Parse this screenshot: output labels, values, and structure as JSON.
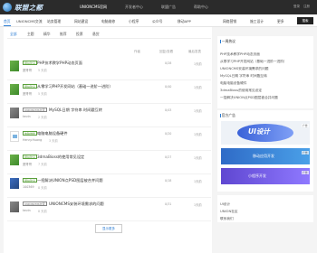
{
  "brand": {
    "logo_text": "联盟之都"
  },
  "top_nav": [
    "UNIONCMS官网",
    "开发者中心",
    "联盟广告",
    "帮助中心"
  ],
  "top_right": [
    "登录",
    "注册"
  ],
  "sub_nav": [
    "首页",
    "UNIONCMS交流",
    "站务管理",
    "网站建设",
    "电脑维修",
    "小程序",
    "公众号",
    "移动APP",
    "网络营销",
    "施工设计",
    "更多"
  ],
  "search_button": "搜索",
  "tabs": [
    "全部",
    "主题",
    "精华",
    "推荐",
    "投票",
    "悬赏"
  ],
  "columns": [
    "作者",
    "回复/查看",
    "最后发表"
  ],
  "threads": [
    {
      "tag": "网站建设",
      "title": "PHP技术教学PHP动态页面",
      "user": "宽哥哥",
      "meta": "5 天前",
      "replies": "0/28",
      "views": "1天前"
    },
    {
      "tag": "网站建设",
      "title": "从零学习PHP开发网站（基础一进阶一进阶）",
      "user": "宽哥哥",
      "meta": "5 天前",
      "replies": "0/40",
      "views": "1天前"
    },
    {
      "tag": "UNIONCMS交流",
      "title": "MySQL日期 字符串 时间戳互转",
      "user": "kevin",
      "meta": "2 天前",
      "replies": "0/43",
      "views": "1天前"
    },
    {
      "tag": "电脑维修",
      "title": "电脑电脑设备硬件",
      "user": "Henry.Huang",
      "meta": "3 天前",
      "replies": "0/20",
      "views": "1天前"
    },
    {
      "tag": "网站建设",
      "title": "3dmaBioss的使用常见设定",
      "user": "宽哥哥",
      "meta": "7 天前",
      "replies": "0/27",
      "views": "1天前"
    },
    {
      "tag": "网站建设",
      "title": "一招解决UNION点PSD图层被合并问题",
      "user": "100369",
      "meta": "8 天前",
      "replies": "0/18",
      "views": "1天前"
    },
    {
      "tag": "UNIONCMS交流",
      "title": "UNIONCMS安装环境需求的问题",
      "user": "kevin",
      "meta": "8 天前",
      "replies": "0/31",
      "views": "1天前"
    }
  ],
  "load_more": "显示更多",
  "hot_panel": {
    "title": "一周热议",
    "links": [
      "PHP技术教学PHP动态页面",
      "从零学习PHP开发网站（基础一进阶一进阶）",
      "UNIONCMS安装环境需求的问题",
      "MySQL日期 字符串 时间戳互转",
      "电脑电脑设备硬件",
      "3dmaBioss的使用常见设定",
      "一招解决UNION点PSD图层被合并问题"
    ]
  },
  "ad_panel": {
    "title": "官方广告",
    "ad1_text": "UI设计",
    "ad2_text": "移动应用开发",
    "ad3_text": "小程序开发",
    "ad_label": "广告"
  },
  "footer_links": [
    "UI设计",
    "UNION社区",
    "联系我们"
  ]
}
